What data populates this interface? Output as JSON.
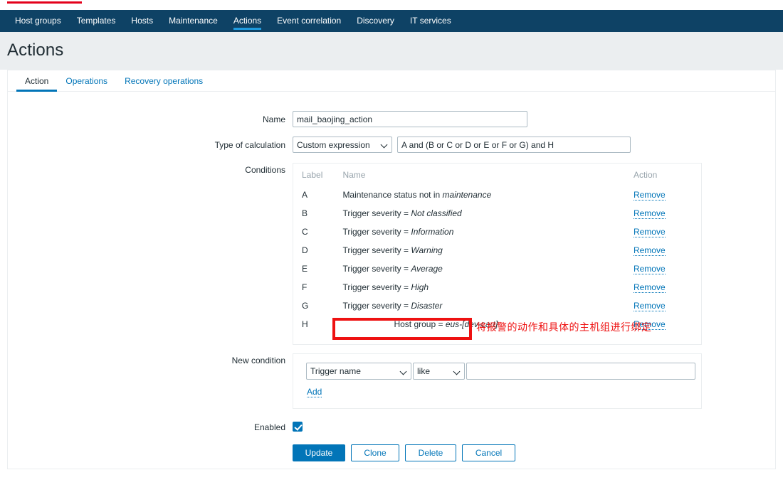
{
  "navbar": {
    "items": [
      {
        "label": "Host groups",
        "active": false
      },
      {
        "label": "Templates",
        "active": false
      },
      {
        "label": "Hosts",
        "active": false
      },
      {
        "label": "Maintenance",
        "active": false
      },
      {
        "label": "Actions",
        "active": true
      },
      {
        "label": "Event correlation",
        "active": false
      },
      {
        "label": "Discovery",
        "active": false
      },
      {
        "label": "IT services",
        "active": false
      }
    ],
    "background_color": "#0e4265",
    "active_underline_color": "#1f9bde"
  },
  "page": {
    "title": "Actions"
  },
  "tabs": [
    {
      "label": "Action",
      "active": true
    },
    {
      "label": "Operations",
      "active": false
    },
    {
      "label": "Recovery operations",
      "active": false
    }
  ],
  "form": {
    "name_label": "Name",
    "name_value": "mail_baojing_action",
    "type_of_calculation_label": "Type of calculation",
    "calculation_select_value": "Custom expression",
    "calculation_expression": "A and (B or C or D or E or F or G) and H",
    "conditions_label": "Conditions",
    "new_condition_label": "New condition",
    "enabled_label": "Enabled",
    "enabled_checked": true
  },
  "conditions": {
    "headers": {
      "label": "Label",
      "name": "Name",
      "action": "Action"
    },
    "rows": [
      {
        "label": "A",
        "name_prefix": "Maintenance status not in ",
        "name_value": "maintenance",
        "action": "Remove"
      },
      {
        "label": "B",
        "name_prefix": "Trigger severity = ",
        "name_value": "Not classified",
        "action": "Remove"
      },
      {
        "label": "C",
        "name_prefix": "Trigger severity = ",
        "name_value": "Information",
        "action": "Remove"
      },
      {
        "label": "D",
        "name_prefix": "Trigger severity = ",
        "name_value": "Warning",
        "action": "Remove"
      },
      {
        "label": "E",
        "name_prefix": "Trigger severity = ",
        "name_value": "Average",
        "action": "Remove"
      },
      {
        "label": "F",
        "name_prefix": "Trigger severity = ",
        "name_value": "High",
        "action": "Remove"
      },
      {
        "label": "G",
        "name_prefix": "Trigger severity = ",
        "name_value": "Disaster",
        "action": "Remove"
      },
      {
        "label": "H",
        "name_prefix": "Host group = ",
        "name_value": "eus-[dev-cart]",
        "action": "Remove"
      }
    ]
  },
  "new_condition": {
    "type_select_value": "Trigger name",
    "operator_select_value": "like",
    "value_input": "",
    "value_placeholder": "",
    "add_link": "Add"
  },
  "footer_buttons": [
    {
      "label": "Update",
      "style": "primary"
    },
    {
      "label": "Clone",
      "style": "secondary"
    },
    {
      "label": "Delete",
      "style": "secondary"
    },
    {
      "label": "Cancel",
      "style": "secondary"
    }
  ],
  "annotations": {
    "chinese_note": "将报警的动作和具体的主机组进行绑定",
    "note_color": "#ee1111",
    "highlight_box_color": "#ee1111",
    "top_line_color": "#e3001b"
  }
}
